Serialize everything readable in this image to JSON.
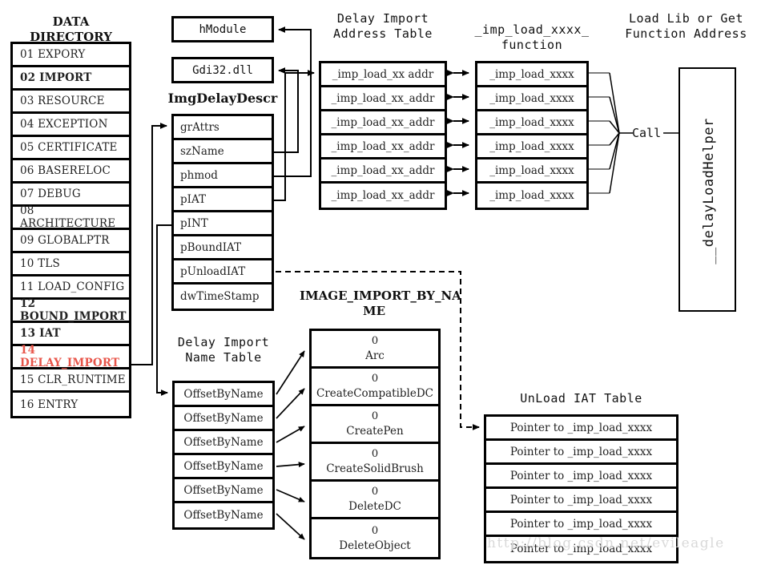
{
  "data_directory": {
    "title": "DATA DIRECTORY",
    "items": [
      {
        "label": "01 EXPORY",
        "style": "normal"
      },
      {
        "label": "02 IMPORT",
        "style": "bold"
      },
      {
        "label": "03 RESOURCE",
        "style": "normal"
      },
      {
        "label": "04 EXCEPTION",
        "style": "normal"
      },
      {
        "label": "05 CERTIFICATE",
        "style": "normal"
      },
      {
        "label": "06 BASERELOC",
        "style": "normal"
      },
      {
        "label": "07 DEBUG",
        "style": "normal"
      },
      {
        "label": "08 ARCHITECTURE",
        "style": "normal"
      },
      {
        "label": "09 GLOBALPTR",
        "style": "normal"
      },
      {
        "label": "10 TLS",
        "style": "normal"
      },
      {
        "label": "11 LOAD_CONFIG",
        "style": "normal"
      },
      {
        "label": "12 BOUND_IMPORT",
        "style": "bold"
      },
      {
        "label": "13 IAT",
        "style": "bold"
      },
      {
        "label": "14 DELAY_IMPORT",
        "style": "red"
      },
      {
        "label": "15 CLR_RUNTIME",
        "style": "normal"
      },
      {
        "label": "16 ENTRY",
        "style": "normal"
      }
    ]
  },
  "hmodule_box": {
    "label": "hModule"
  },
  "gdi32_box": {
    "label": "Gdi32.dll"
  },
  "img_delay_descr": {
    "title": "ImgDelayDescr",
    "fields": [
      "grAttrs",
      "szName",
      "phmod",
      "pIAT",
      "pINT",
      "pBoundIAT",
      "pUnloadIAT",
      "dwTimeStamp"
    ]
  },
  "delay_import_address_table": {
    "title": "Delay Import\nAddress Table",
    "rows": [
      "_imp_load_xx addr",
      "_imp_load_xx_addr",
      "_imp_load_xx_addr",
      "_imp_load_xx_addr",
      "_imp_load_xx_addr",
      "_imp_load_xx_addr"
    ]
  },
  "imp_load_function_table": {
    "title": "_imp_load_xxxx_\nfunction",
    "rows": [
      "_imp_load_xxxx",
      "_imp_load_xxxx",
      "_imp_load_xxxx",
      "_imp_load_xxxx",
      "_imp_load_xxxx",
      "_imp_load_xxxx"
    ]
  },
  "load_lib": {
    "title": "Load Lib or Get\nFunction Address",
    "call_label": "Call",
    "helper_label": "__delayLoadHelper"
  },
  "delay_import_name_table": {
    "title": "Delay Import\nName Table",
    "rows": [
      "OffsetByName",
      "OffsetByName",
      "OffsetByName",
      "OffsetByName",
      "OffsetByName",
      "OffsetByName"
    ]
  },
  "image_import_by_name": {
    "title": "IMAGE_IMPORT_BY_NA\nME",
    "rows": [
      {
        "ordinal": "0",
        "name": "Arc"
      },
      {
        "ordinal": "0",
        "name": "CreateCompatibleDC"
      },
      {
        "ordinal": "0",
        "name": "CreatePen"
      },
      {
        "ordinal": "0",
        "name": "CreateSolidBrush"
      },
      {
        "ordinal": "0",
        "name": "DeleteDC"
      },
      {
        "ordinal": "0",
        "name": "DeleteObject"
      }
    ]
  },
  "unload_iat_table": {
    "title": "UnLoad IAT Table",
    "rows": [
      "Pointer to _imp_load_xxxx",
      "Pointer to _imp_load_xxxx",
      "Pointer to _imp_load_xxxx",
      "Pointer to _imp_load_xxxx",
      "Pointer to _imp_load_xxxx",
      "Pointer to _imp_load_xxxx"
    ]
  },
  "watermark": {
    "text": "http://blog.csdn.net/evileagle"
  },
  "colors": {
    "stroke": "#000000",
    "highlight": "#e8554a",
    "background": "#ffffff",
    "watermark": "#d9d9d9"
  }
}
